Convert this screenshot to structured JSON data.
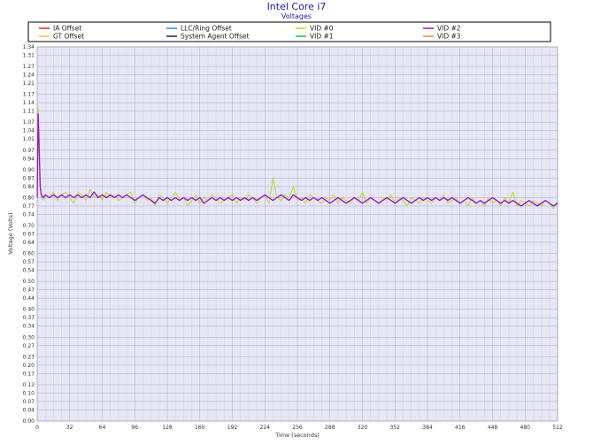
{
  "chart_data": {
    "type": "line",
    "title": "Intel Core i7",
    "subtitle": "Voltages",
    "xlabel": "Time (seconds)",
    "ylabel": "Voltage (Volts)",
    "xlim": [
      0,
      512
    ],
    "ylim": [
      0,
      1.34
    ],
    "x_ticks": [
      "0",
      "32",
      "64",
      "96",
      "128",
      "160",
      "192",
      "224",
      "256",
      "288",
      "320",
      "352",
      "384",
      "416",
      "448",
      "480",
      "512"
    ],
    "y_ticks": [
      "0.00",
      "0.04",
      "0.07",
      "0.10",
      "0.13",
      "0.17",
      "0.20",
      "0.23",
      "0.27",
      "0.30",
      "0.34",
      "0.37",
      "0.40",
      "0.44",
      "0.47",
      "0.50",
      "0.54",
      "0.57",
      "0.60",
      "0.64",
      "0.67",
      "0.70",
      "0.74",
      "0.77",
      "0.80",
      "0.84",
      "0.87",
      "0.90",
      "0.94",
      "0.97",
      "1.01",
      "1.04",
      "1.07",
      "1.11",
      "1.14",
      "1.17",
      "1.21",
      "1.24",
      "1.27",
      "1.31",
      "1.34"
    ],
    "y_tick_values": [
      0.0,
      0.04,
      0.07,
      0.1,
      0.13,
      0.17,
      0.2,
      0.23,
      0.27,
      0.3,
      0.34,
      0.37,
      0.4,
      0.44,
      0.47,
      0.5,
      0.54,
      0.57,
      0.6,
      0.64,
      0.67,
      0.7,
      0.74,
      0.77,
      0.8,
      0.84,
      0.87,
      0.9,
      0.94,
      0.97,
      1.01,
      1.04,
      1.07,
      1.11,
      1.14,
      1.17,
      1.21,
      1.24,
      1.27,
      1.31,
      1.34
    ],
    "legend": [
      {
        "name": "IA Offset",
        "color": "#e02020"
      },
      {
        "name": "LLC/Ring Offset",
        "color": "#2a8fbf"
      },
      {
        "name": "VID #0",
        "color": "#b4e020"
      },
      {
        "name": "VID #2",
        "color": "#9a10c8"
      },
      {
        "name": "GT Offset",
        "color": "#f0c040"
      },
      {
        "name": "System Agent Offset",
        "color": "#20205a"
      },
      {
        "name": "VID #1",
        "color": "#20c040"
      },
      {
        "name": "VID #3",
        "color": "#d09030"
      }
    ],
    "legend_placement": "top",
    "grid": true,
    "series": [
      {
        "name": "VID #0",
        "color": "#b4e020",
        "x": [
          0,
          1,
          2,
          3,
          4,
          6,
          8,
          12,
          16,
          20,
          24,
          28,
          32,
          36,
          40,
          44,
          48,
          52,
          56,
          60,
          64,
          68,
          72,
          76,
          80,
          84,
          88,
          92,
          96,
          100,
          104,
          108,
          112,
          116,
          120,
          124,
          128,
          132,
          136,
          140,
          144,
          148,
          152,
          156,
          160,
          164,
          168,
          172,
          176,
          180,
          184,
          188,
          192,
          196,
          200,
          204,
          208,
          212,
          216,
          220,
          224,
          228,
          232,
          236,
          240,
          244,
          248,
          252,
          256,
          260,
          264,
          268,
          272,
          276,
          280,
          284,
          288,
          292,
          296,
          300,
          304,
          308,
          312,
          316,
          320,
          324,
          328,
          332,
          336,
          340,
          344,
          348,
          352,
          356,
          360,
          364,
          368,
          372,
          376,
          380,
          384,
          388,
          392,
          396,
          400,
          404,
          408,
          412,
          416,
          420,
          424,
          428,
          432,
          436,
          440,
          444,
          448,
          452,
          456,
          460,
          464,
          468,
          472,
          476,
          480,
          484,
          488,
          492,
          496,
          500,
          504,
          508,
          512
        ],
        "y": [
          0.8,
          1.12,
          0.99,
          0.85,
          0.8,
          0.79,
          0.81,
          0.8,
          0.82,
          0.79,
          0.81,
          0.82,
          0.8,
          0.78,
          0.82,
          0.81,
          0.79,
          0.83,
          0.8,
          0.81,
          0.79,
          0.82,
          0.8,
          0.81,
          0.79,
          0.8,
          0.81,
          0.82,
          0.78,
          0.8,
          0.81,
          0.79,
          0.8,
          0.77,
          0.81,
          0.8,
          0.78,
          0.8,
          0.82,
          0.79,
          0.8,
          0.77,
          0.79,
          0.81,
          0.78,
          0.8,
          0.79,
          0.81,
          0.8,
          0.78,
          0.79,
          0.8,
          0.81,
          0.78,
          0.8,
          0.79,
          0.81,
          0.8,
          0.78,
          0.8,
          0.81,
          0.78,
          0.87,
          0.8,
          0.79,
          0.81,
          0.8,
          0.84,
          0.79,
          0.8,
          0.78,
          0.81,
          0.8,
          0.79,
          0.78,
          0.8,
          0.79,
          0.81,
          0.78,
          0.8,
          0.79,
          0.78,
          0.8,
          0.79,
          0.82,
          0.78,
          0.8,
          0.79,
          0.78,
          0.8,
          0.79,
          0.81,
          0.78,
          0.8,
          0.79,
          0.77,
          0.8,
          0.79,
          0.78,
          0.8,
          0.79,
          0.78,
          0.8,
          0.79,
          0.81,
          0.78,
          0.79,
          0.8,
          0.78,
          0.79,
          0.77,
          0.8,
          0.78,
          0.79,
          0.77,
          0.8,
          0.78,
          0.79,
          0.77,
          0.8,
          0.78,
          0.82,
          0.77,
          0.79,
          0.78,
          0.77,
          0.79,
          0.78,
          0.77,
          0.79,
          0.78,
          0.76,
          0.79
        ]
      },
      {
        "name": "VID #2",
        "color": "#9a10c8",
        "x": [
          0,
          1,
          2,
          3,
          4,
          6,
          8,
          12,
          16,
          20,
          24,
          28,
          32,
          36,
          40,
          44,
          48,
          52,
          56,
          60,
          64,
          68,
          72,
          76,
          80,
          84,
          88,
          92,
          96,
          100,
          104,
          108,
          112,
          116,
          120,
          124,
          128,
          132,
          136,
          140,
          144,
          148,
          152,
          156,
          160,
          164,
          168,
          172,
          176,
          180,
          184,
          188,
          192,
          196,
          200,
          204,
          208,
          212,
          216,
          220,
          224,
          228,
          232,
          236,
          240,
          244,
          248,
          252,
          256,
          260,
          264,
          268,
          272,
          276,
          280,
          284,
          288,
          292,
          296,
          300,
          304,
          308,
          312,
          316,
          320,
          324,
          328,
          332,
          336,
          340,
          344,
          348,
          352,
          356,
          360,
          364,
          368,
          372,
          376,
          380,
          384,
          388,
          392,
          396,
          400,
          404,
          408,
          412,
          416,
          420,
          424,
          428,
          432,
          436,
          440,
          444,
          448,
          452,
          456,
          460,
          464,
          468,
          472,
          476,
          480,
          484,
          488,
          492,
          496,
          500,
          504,
          508,
          512
        ],
        "y": [
          0.8,
          1.1,
          0.97,
          0.84,
          0.81,
          0.8,
          0.81,
          0.8,
          0.81,
          0.8,
          0.81,
          0.8,
          0.81,
          0.8,
          0.81,
          0.8,
          0.81,
          0.8,
          0.82,
          0.8,
          0.81,
          0.8,
          0.81,
          0.8,
          0.81,
          0.8,
          0.81,
          0.8,
          0.79,
          0.8,
          0.81,
          0.8,
          0.79,
          0.78,
          0.8,
          0.79,
          0.8,
          0.79,
          0.8,
          0.79,
          0.8,
          0.79,
          0.8,
          0.79,
          0.8,
          0.78,
          0.79,
          0.8,
          0.79,
          0.8,
          0.79,
          0.8,
          0.79,
          0.8,
          0.79,
          0.8,
          0.79,
          0.8,
          0.79,
          0.8,
          0.81,
          0.8,
          0.79,
          0.8,
          0.81,
          0.8,
          0.79,
          0.81,
          0.8,
          0.79,
          0.8,
          0.79,
          0.8,
          0.79,
          0.8,
          0.79,
          0.78,
          0.79,
          0.8,
          0.79,
          0.78,
          0.79,
          0.8,
          0.79,
          0.78,
          0.79,
          0.8,
          0.79,
          0.78,
          0.79,
          0.8,
          0.79,
          0.78,
          0.79,
          0.8,
          0.79,
          0.78,
          0.79,
          0.8,
          0.79,
          0.8,
          0.79,
          0.8,
          0.79,
          0.8,
          0.79,
          0.8,
          0.79,
          0.78,
          0.79,
          0.8,
          0.79,
          0.78,
          0.79,
          0.78,
          0.79,
          0.8,
          0.79,
          0.78,
          0.79,
          0.78,
          0.79,
          0.78,
          0.77,
          0.78,
          0.79,
          0.78,
          0.77,
          0.78,
          0.79,
          0.78,
          0.77,
          0.78
        ]
      }
    ]
  }
}
